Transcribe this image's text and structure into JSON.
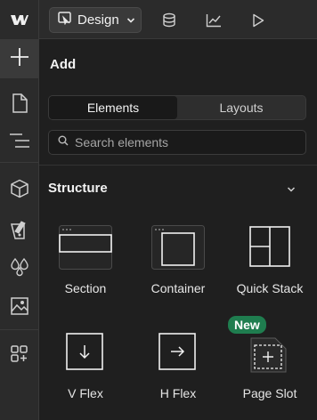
{
  "topbar": {
    "design_label": "Design",
    "icons": [
      "webflow-logo-icon",
      "paintbrush-icon",
      "database-icon",
      "chart-icon",
      "play-icon"
    ]
  },
  "rail": {
    "items": [
      "add-icon",
      "page-icon",
      "navigator-icon",
      "component-icon",
      "style-icon",
      "variables-icon",
      "assets-icon",
      "apps-icon"
    ]
  },
  "panel": {
    "title": "Add",
    "tabs": [
      {
        "label": "Elements",
        "active": true
      },
      {
        "label": "Layouts",
        "active": false
      }
    ],
    "search": {
      "placeholder": "Search elements",
      "value": ""
    },
    "section": {
      "title": "Structure",
      "expanded": true
    },
    "elements": [
      {
        "label": "Section"
      },
      {
        "label": "Container"
      },
      {
        "label": "Quick Stack"
      },
      {
        "label": "V Flex"
      },
      {
        "label": "H Flex"
      },
      {
        "label": "Page Slot",
        "badge": "New"
      }
    ]
  },
  "colors": {
    "background": "#1e1e1e",
    "panel": "#1f1f1f",
    "toolbar": "#2b2b2b",
    "badge": "#1f7d4f"
  }
}
